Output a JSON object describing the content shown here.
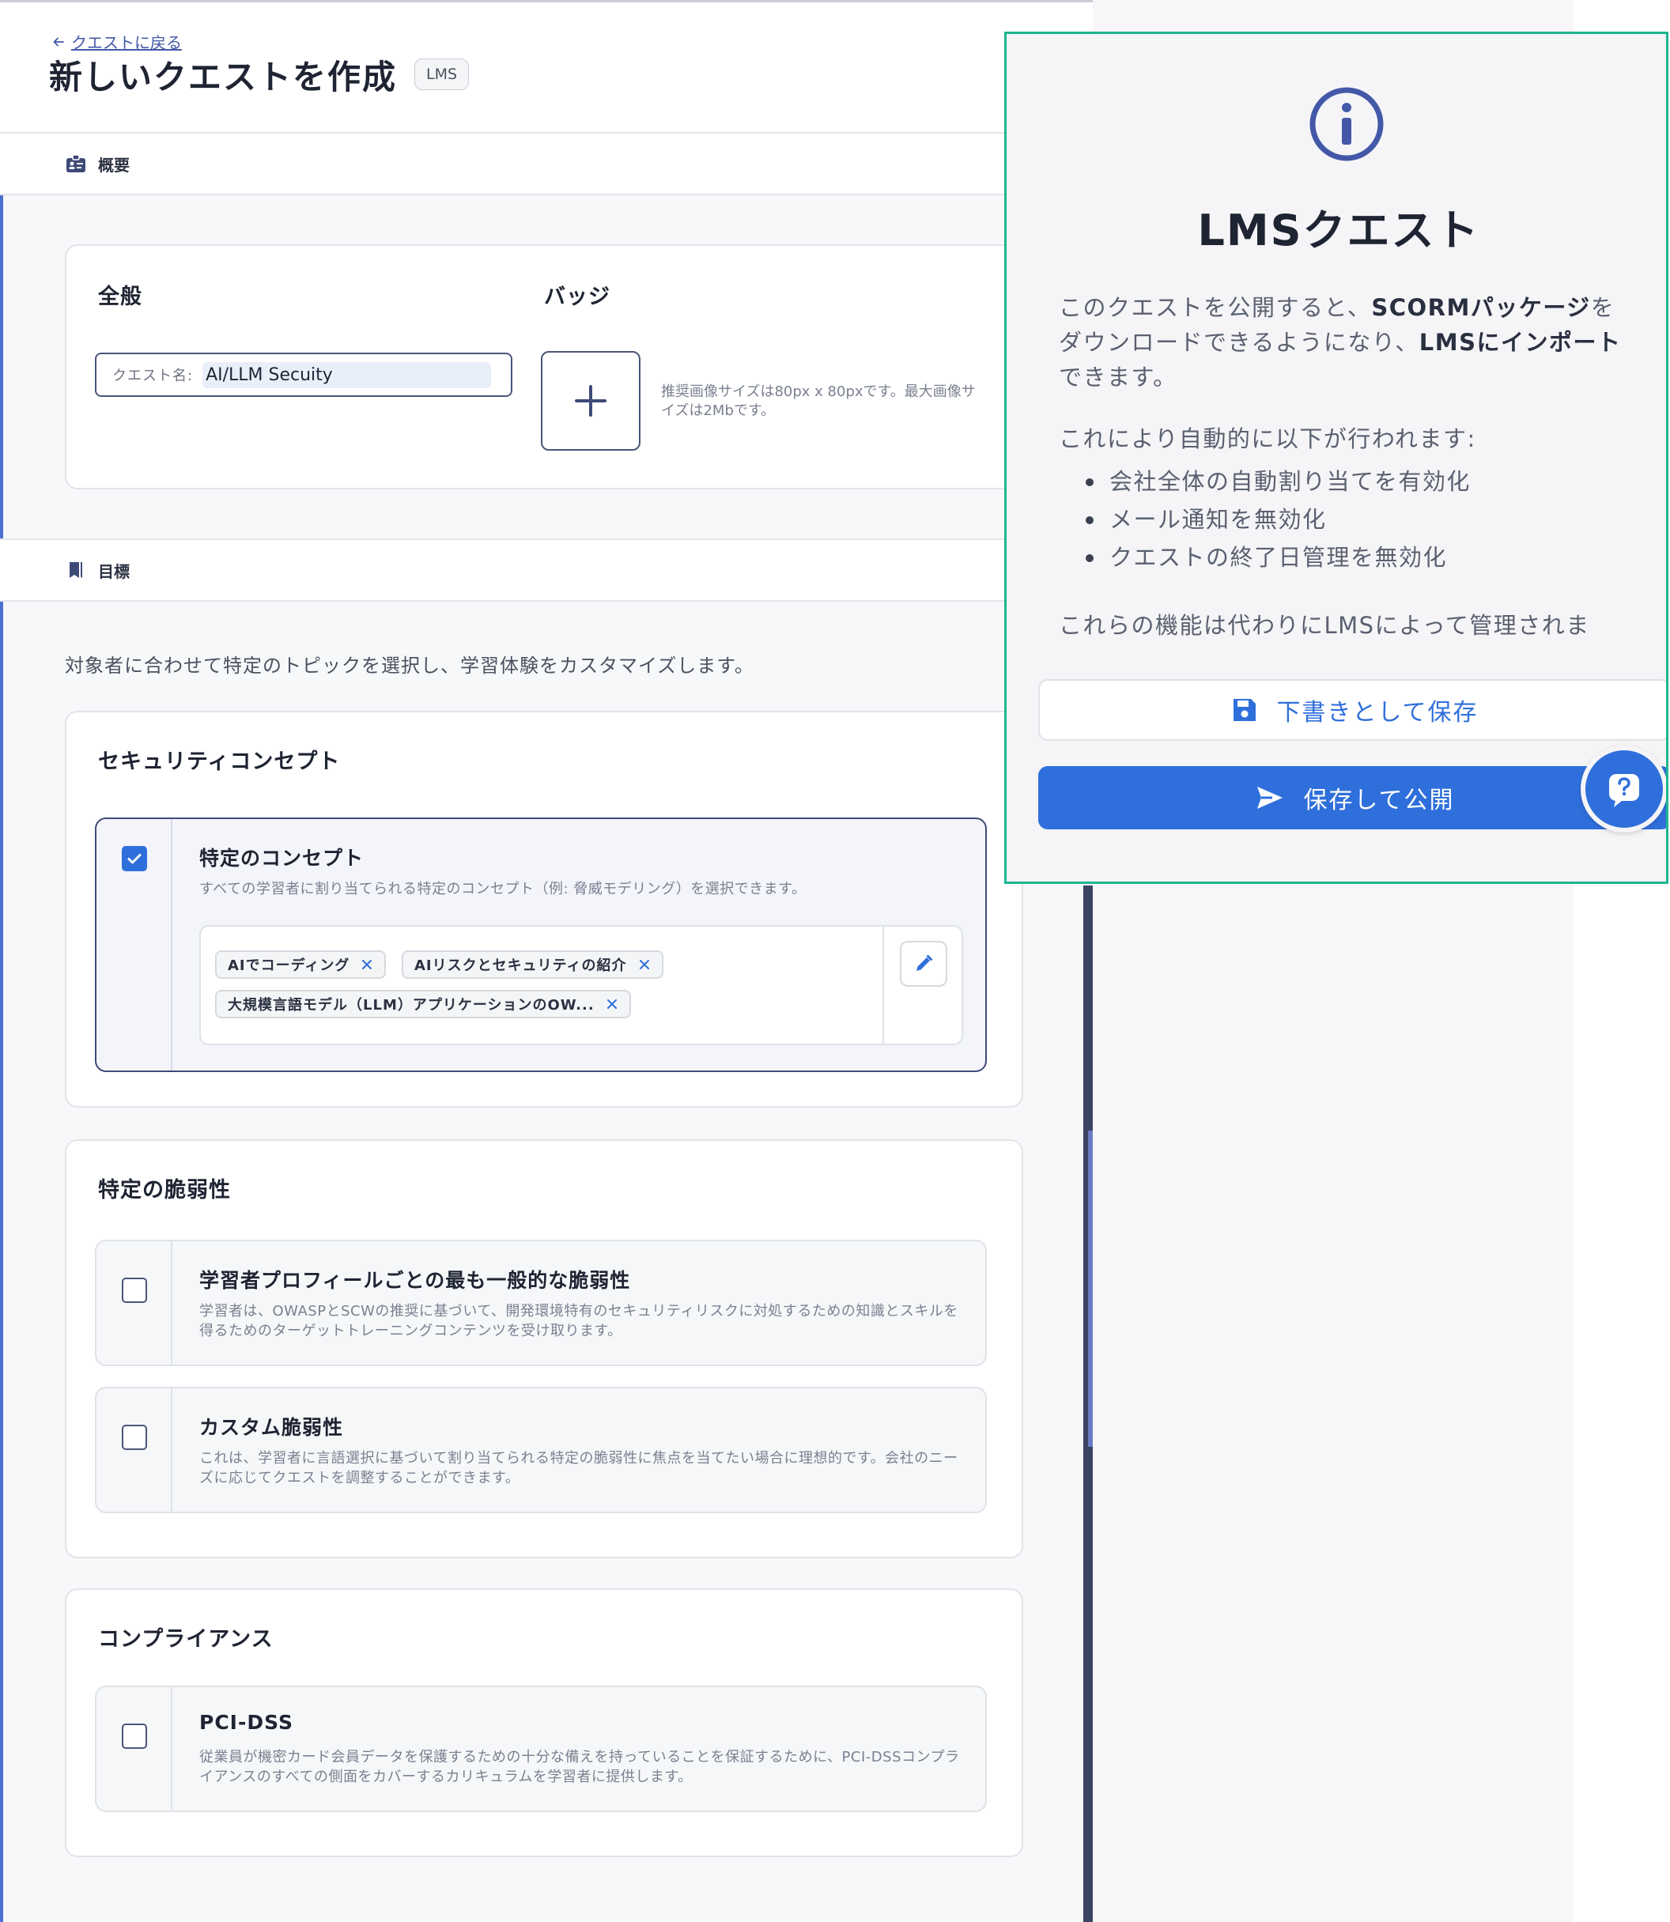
{
  "header": {
    "back_label": "クエストに戻る",
    "title": "新しいクエストを作成",
    "chip": "LMS"
  },
  "overview": {
    "section_label": "概要",
    "general_heading": "全般",
    "badge_heading": "バッジ",
    "quest_name_label": "クエスト名:",
    "quest_name_value": "AI/LLM Secuity",
    "badge_hint": "推奨画像サイズは80px x 80pxです。最大画像サイズは2Mbです。"
  },
  "goals": {
    "section_label": "目標",
    "description": "対象者に合わせて特定のトピックを選択し、学習体験をカスタマイズします。",
    "security_concepts": {
      "heading": "セキュリティコンセプト",
      "option": {
        "title": "特定のコンセプト",
        "subtitle": "すべての学習者に割り当てられる特定のコンセプト（例: 脅威モデリング）を選択できます。",
        "checked": true,
        "tags": [
          "AIでコーディング",
          "AIリスクとセキュリティの紹介",
          "大規模言語モデル（LLM）アプリケーションのOW..."
        ]
      }
    },
    "vulnerabilities": {
      "heading": "特定の脆弱性",
      "options": [
        {
          "title": "学習者プロフィールごとの最も一般的な脆弱性",
          "subtitle": "学習者は、OWASPとSCWの推奨に基づいて、開発環境特有のセキュリティリスクに対処するための知識とスキルを得るためのターゲットトレーニングコンテンツを受け取ります。",
          "checked": false
        },
        {
          "title": "カスタム脆弱性",
          "subtitle": "これは、学習者に言語選択に基づいて割り当てられる特定の脆弱性に焦点を当てたい場合に理想的です。会社のニーズに応じてクエストを調整することができます。",
          "checked": false
        }
      ]
    },
    "compliance": {
      "heading": "コンプライアンス",
      "option": {
        "title": "PCI-DSS",
        "subtitle": "従業員が機密カード会員データを保護するための十分な備えを持っていることを保証するために、PCI-DSSコンプライアンスのすべての側面をカバーするカリキュラムを学習者に提供します。",
        "checked": false
      }
    }
  },
  "lms_panel": {
    "title": "LMSクエスト",
    "para1_a": "このクエストを公開すると、",
    "para1_b": "SCORMパッケージ",
    "para1_c": "をダウンロードできるようになり、",
    "para1_d": "LMSにインポート",
    "para1_e": "できます。",
    "para2": "これにより自動的に以下が行われます:",
    "bullets": [
      "会社全体の自動割り当てを有効化",
      "メール通知を無効化",
      "クエストの終了日管理を無効化"
    ],
    "para3": "これらの機能は代わりにLMSによって管理されま",
    "draft_button": "下書きとして保存",
    "publish_button": "保存して公開"
  },
  "colors": {
    "accent": "#2f6fdb",
    "panel_border": "#1fb58f",
    "navy": "#4a5578"
  }
}
